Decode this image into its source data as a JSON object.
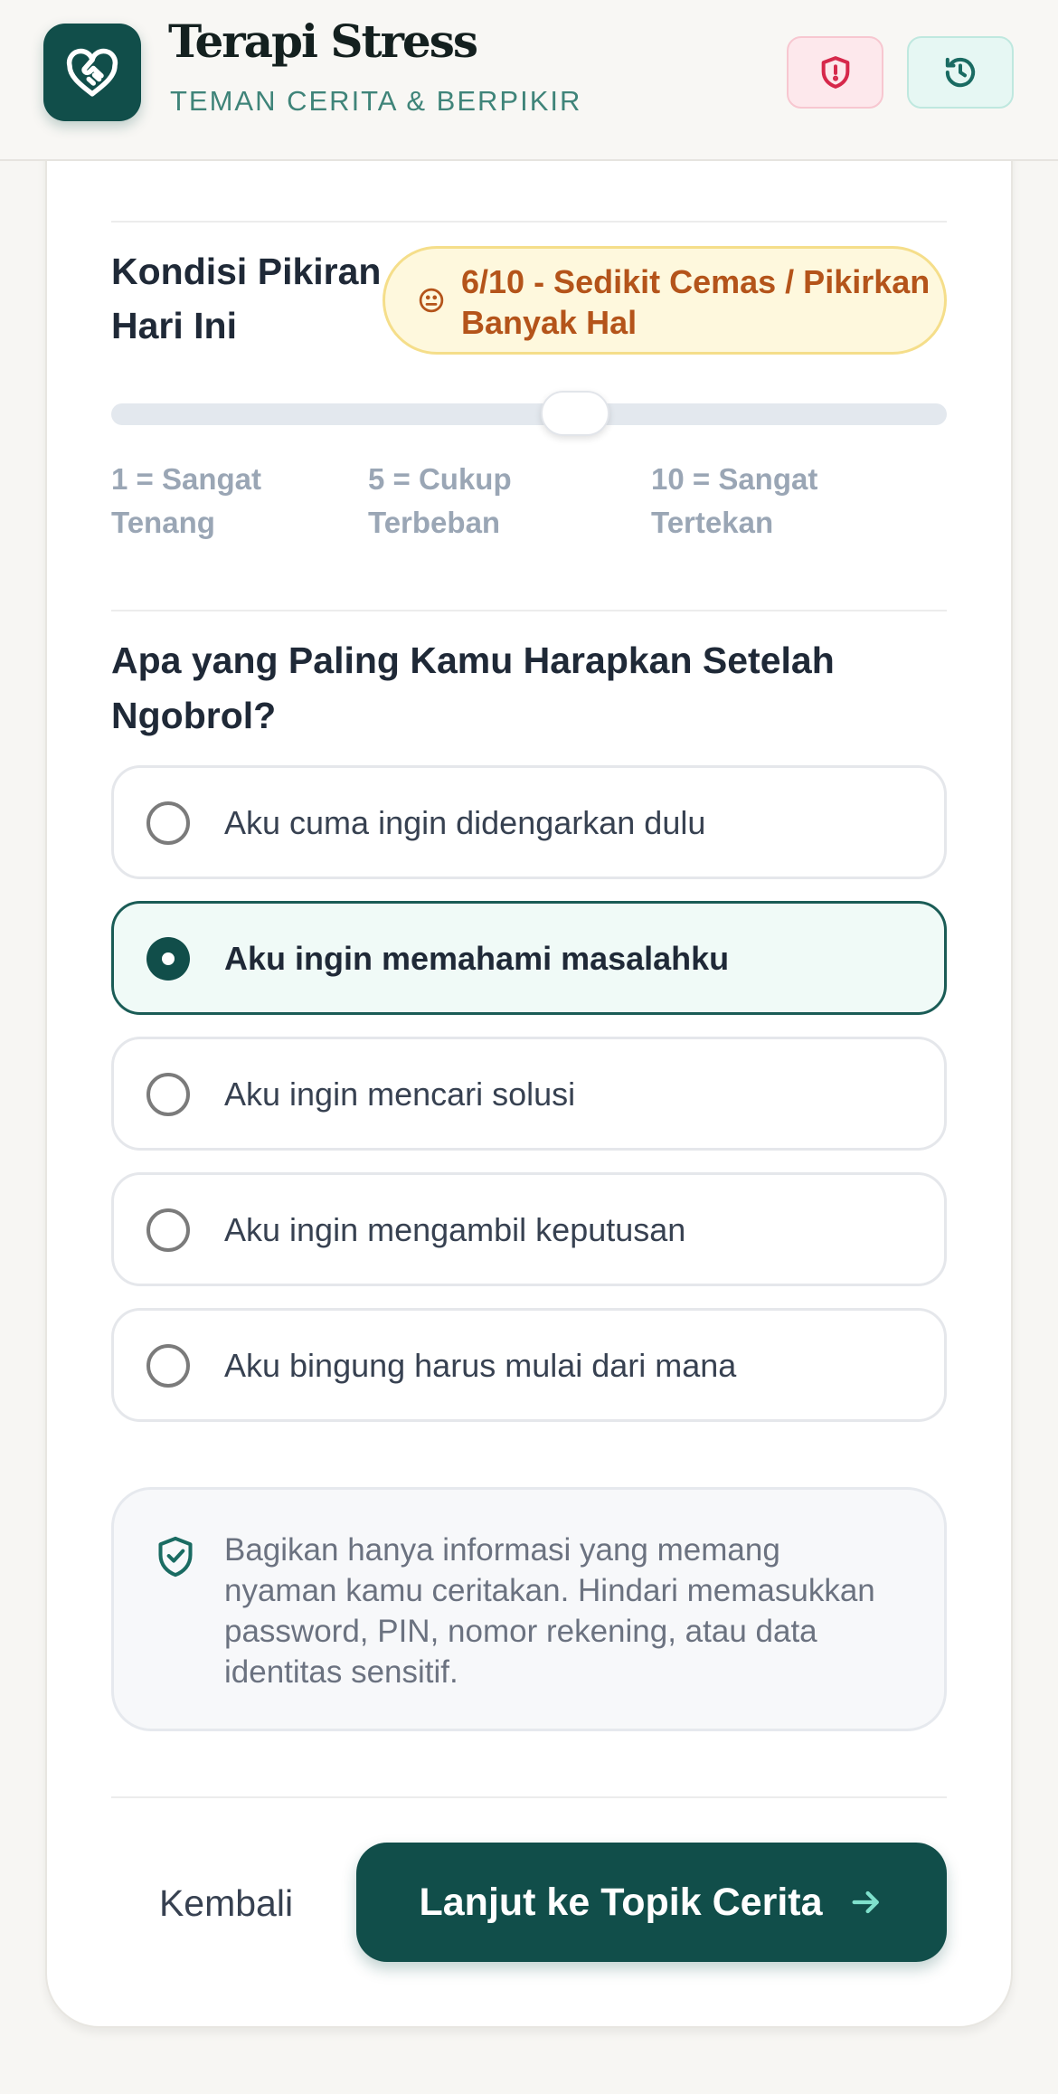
{
  "app": {
    "title": "Terapi Stress",
    "subtitle": "TEMAN CERITA & BERPIKIR"
  },
  "header_buttons": {
    "safety_icon": "shield-alert-icon",
    "history_icon": "history-icon"
  },
  "mood": {
    "label": "Kondisi Pikiran Hari Ini",
    "badge_text": "6/10 - Sedikit Cemas / Pikirkan Banyak Hal",
    "value": 6,
    "min": 1,
    "max": 10,
    "scale_labels": [
      "1 = Sangat Tenang",
      "5 = Cukup Terbeban",
      "10 = Sangat Tertekan"
    ]
  },
  "question": {
    "title": "Apa yang Paling Kamu Harapkan Setelah Ngobrol?",
    "selected_index": 1,
    "options": [
      "Aku cuma ingin didengarkan dulu",
      "Aku ingin memahami masalahku",
      "Aku ingin mencari solusi",
      "Aku ingin mengambil keputusan",
      "Aku bingung harus mulai dari mana"
    ]
  },
  "privacy_note": "Bagikan hanya informasi yang memang nyaman kamu ceritakan. Hindari memasukkan password, PIN, nomor rekening, atau data identitas sensitif.",
  "actions": {
    "back_label": "Kembali",
    "next_label": "Lanjut ke Topik Cerita"
  },
  "colors": {
    "primary": "#114e4a",
    "accent_text": "#3f8479",
    "badge_bg": "#fef8dd",
    "badge_text": "#b4541a"
  }
}
